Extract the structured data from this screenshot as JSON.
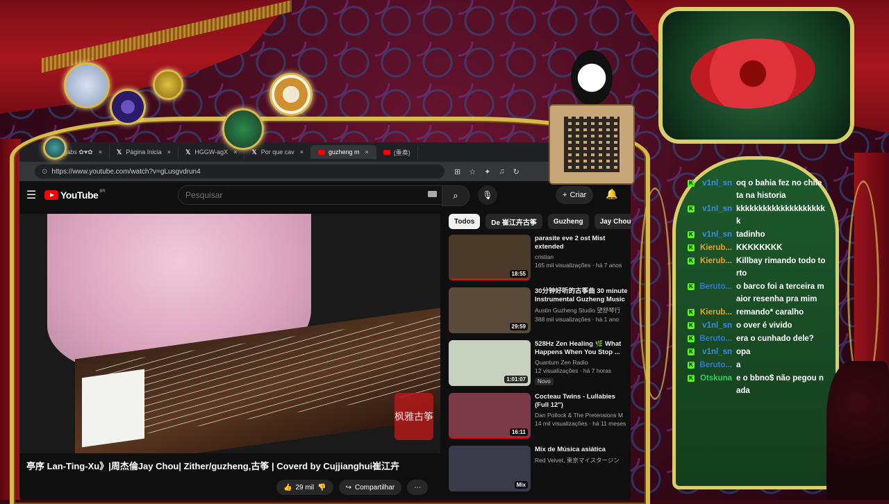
{
  "browser": {
    "tabs": [
      {
        "label": "gabs ✿♥✿",
        "icon": "x-icon"
      },
      {
        "label": "Página Inicia",
        "icon": "x-icon"
      },
      {
        "label": "HGGW-agX",
        "icon": "x-icon"
      },
      {
        "label": "Por que cav",
        "icon": "x-icon"
      },
      {
        "label": "guzheng m",
        "icon": "youtube-icon",
        "active": true
      },
      {
        "label": "(重奏)",
        "icon": "youtube-icon"
      }
    ],
    "url": "https://www.youtube.com/watch?v=gLusgvdrun4"
  },
  "youtube": {
    "logo_text": "YouTube",
    "region": "BR",
    "search_placeholder": "Pesquisar",
    "create_label": "Criar",
    "video_title": "亭序 Lan-Ting-Xu》|周杰倫Jay Chou| Zither/guzheng,古筝 | Coverd by Cujjianghui崔江卉",
    "seal_text": "枫雅古筝",
    "likes": "29 mil",
    "share_label": "Compartilhar",
    "chips": [
      "Todos",
      "De 崔江卉古筝",
      "Guzheng",
      "Jay Chou"
    ],
    "recommendations": [
      {
        "title": "parasite eve 2 ost Mist extended",
        "channel": "cristian",
        "views": "165 mil visualizações · há 7 anos",
        "duration": "18:55",
        "thumb": "#4a3a2a",
        "progress": 1.0
      },
      {
        "title": "30分钟好听的古筝曲 30 minute Instrumental Guzheng Music",
        "channel": "Austin Guzheng Studio 望舒琴行",
        "views": "388 mil visualizações · há 1 ano",
        "duration": "29:59",
        "thumb": "#5a4a3a",
        "progress": 0.0
      },
      {
        "title": "528Hz Zen Healing 🌿 What Happens When You Stop ...",
        "channel": "Quantum Zen Radio",
        "views": "12 visualizações · há 7 horas",
        "duration": "1:01:07",
        "thumb": "#c8d0c0",
        "progress": 0.0,
        "badge": "Novo"
      },
      {
        "title": "Cocteau Twins - Lullabies (Full 12\")",
        "channel": "Dan Pollock & The Pretensions M",
        "views": "14 mil visualizações · há 11 meses",
        "duration": "16:11",
        "thumb": "#7a3a4a",
        "progress": 1.0
      },
      {
        "title": "Mix de Música asiática",
        "channel": "Red Velvet, 東京マイスタージン",
        "views": "",
        "duration": "Mix",
        "thumb": "#3a3a4a",
        "progress": 0.0
      }
    ]
  },
  "chat": [
    {
      "user": "v1nl_sn",
      "color": "blue",
      "text": "oq o bahia fez no chile ta na historia"
    },
    {
      "user": "v1nl_sn",
      "color": "blue",
      "text": "kkkkkkkkkkkkkkkkkkkkk"
    },
    {
      "user": "v1nl_sn",
      "color": "blue",
      "text": "tadinho"
    },
    {
      "user": "Kierub...",
      "color": "orange",
      "text": "KKKKKKKK"
    },
    {
      "user": "Kierub...",
      "color": "orange",
      "text": "Killbay rimando todo torto"
    },
    {
      "user": "Beruto...",
      "color": "blue2",
      "text": "o barco foi a terceira maior resenha pra mim"
    },
    {
      "user": "Kierub...",
      "color": "orange",
      "text": "remando* caralho"
    },
    {
      "user": "v1nl_sn",
      "color": "blue",
      "text": "o over é vivido"
    },
    {
      "user": "Beruto...",
      "color": "blue2",
      "text": "era o cunhado dele?"
    },
    {
      "user": "v1nl_sn",
      "color": "blue",
      "text": "opa"
    },
    {
      "user": "Beruto...",
      "color": "blue2",
      "text": "a"
    },
    {
      "user": "Otskuna",
      "color": "green",
      "text": "e o bbno$ não pegou nada"
    }
  ],
  "colors": {
    "gold": "#d9b94a",
    "chat_bg": "#1e5a2c",
    "kick_green": "#53fc18",
    "yt_red": "#ff0000"
  }
}
